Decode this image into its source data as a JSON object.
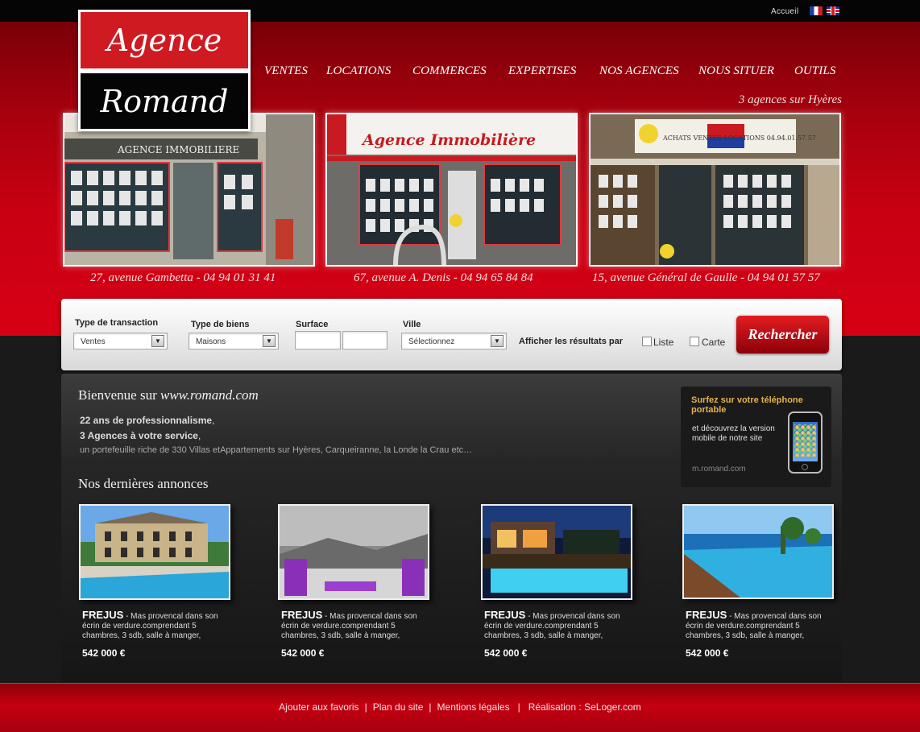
{
  "topbar": {
    "home_label": "Accueil"
  },
  "logo": {
    "line1": "Agence",
    "line2": "Romand"
  },
  "nav": [
    "VENTES",
    "LOCATIONS",
    "COMMERCES",
    "EXPERTISES",
    "NOS AGENCES",
    "NOUS SITUER",
    "OUTILS"
  ],
  "tagline": "3 agences sur Hyères",
  "agencies": [
    {
      "address": "27, avenue Gambetta - 04 94 01 31 41",
      "sign": "AGENCE IMMOBILIERE"
    },
    {
      "address": "67, avenue A. Denis - 04 94 65 84 84",
      "sign": "Agence Immobilière"
    },
    {
      "address": "15, avenue Général de Gaulle - 04 94 01 57 57",
      "sign": "ACHATS VENTES LOCATIONS 04.94.01.57.57"
    }
  ],
  "search": {
    "transaction_label": "Type de transaction",
    "transaction_value": "Ventes",
    "property_label": "Type de biens",
    "property_value": "Maisons",
    "surface_label": "Surface",
    "city_label": "Ville",
    "city_value": "Sélectionnez",
    "display_label": "Afficher les résultats par",
    "list_label": "Liste",
    "map_label": "Carte",
    "submit_label": "Rechercher"
  },
  "welcome": {
    "prefix": "Bienvenue sur ",
    "site": "www.romand.com",
    "line1": "22 ans de professionnalisme",
    "line1_end": ",",
    "line2": "3 Agences à votre service",
    "line2_end": ",",
    "line3": "un portefeuille riche de 330 Villas etAppartements sur Hyères, Carqueiranne, la Londe la Crau etc…"
  },
  "mobile": {
    "title": "Surfez sur votre téléphone portable",
    "desc": "et découvrez la version mobile de notre site",
    "url": "m.romand.com"
  },
  "latest_title": "Nos dernières annonces",
  "listings": [
    {
      "city": "FREJUS",
      "desc": " - Mas provencal dans son écrin de verdure.comprendant 5 chambres, 3 sdb, salle à manger,",
      "price": "542 000 €"
    },
    {
      "city": "FREJUS",
      "desc": " - Mas provencal dans son écrin de verdure.comprendant 5 chambres, 3 sdb, salle à manger,",
      "price": "542 000 €"
    },
    {
      "city": "FREJUS",
      "desc": " - Mas provencal dans son écrin de verdure.comprendant 5 chambres, 3 sdb, salle à manger,",
      "price": "542 000 €"
    },
    {
      "city": "FREJUS",
      "desc": " - Mas provencal dans son écrin de verdure.comprendant 5 chambres, 3 sdb, salle à manger,",
      "price": "542 000 €"
    }
  ],
  "footer": {
    "links": [
      "Ajouter aux favoris",
      "Plan du site",
      "Mentions légales",
      "Réalisation : SeLoger.com"
    ],
    "separator": "|"
  }
}
